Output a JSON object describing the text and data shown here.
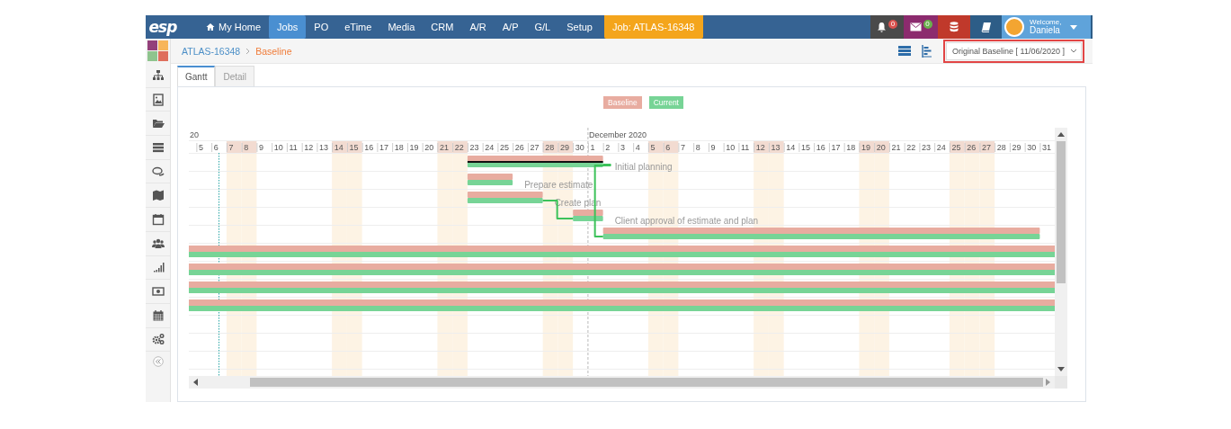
{
  "topbar": {
    "logo": "esp",
    "nav": [
      {
        "label": "My Home",
        "kind": "home",
        "selected": false
      },
      {
        "label": "Jobs",
        "kind": "plain",
        "selected": true
      },
      {
        "label": "PO",
        "kind": "plain",
        "selected": false
      },
      {
        "label": "eTime",
        "kind": "plain",
        "selected": false
      },
      {
        "label": "Media",
        "kind": "plain",
        "selected": false
      },
      {
        "label": "CRM",
        "kind": "plain",
        "selected": false
      },
      {
        "label": "A/R",
        "kind": "plain",
        "selected": false
      },
      {
        "label": "A/P",
        "kind": "plain",
        "selected": false
      },
      {
        "label": "G/L",
        "kind": "plain",
        "selected": false
      },
      {
        "label": "Setup",
        "kind": "plain",
        "selected": false
      }
    ],
    "job_button": "Job: ATLAS-16348",
    "notifications": {
      "count": "0"
    },
    "messages": {
      "count": "0"
    },
    "user": {
      "greeting": "Welcome,",
      "name": "Daniela"
    }
  },
  "breadcrumb": {
    "parent": "ATLAS-16348",
    "current": "Baseline"
  },
  "baseline_select": {
    "value": "Original Baseline [ 11/06/2020 ]"
  },
  "tabs": [
    {
      "label": "Gantt",
      "selected": true
    },
    {
      "label": "Detail",
      "selected": false
    }
  ],
  "legend": {
    "baseline": "Baseline",
    "current": "Current"
  },
  "timeline": {
    "months": [
      {
        "label": "20"
      },
      {
        "label": "December 2020"
      }
    ],
    "days": [
      {
        "label": "5",
        "weekend": false
      },
      {
        "label": "6",
        "weekend": false
      },
      {
        "label": "7",
        "weekend": true
      },
      {
        "label": "8",
        "weekend": true
      },
      {
        "label": "9",
        "weekend": false
      },
      {
        "label": "10",
        "weekend": false
      },
      {
        "label": "11",
        "weekend": false
      },
      {
        "label": "12",
        "weekend": false
      },
      {
        "label": "13",
        "weekend": false
      },
      {
        "label": "14",
        "weekend": true
      },
      {
        "label": "15",
        "weekend": true
      },
      {
        "label": "16",
        "weekend": false
      },
      {
        "label": "17",
        "weekend": false
      },
      {
        "label": "18",
        "weekend": false
      },
      {
        "label": "19",
        "weekend": false
      },
      {
        "label": "20",
        "weekend": false
      },
      {
        "label": "21",
        "weekend": true
      },
      {
        "label": "22",
        "weekend": true
      },
      {
        "label": "23",
        "weekend": false
      },
      {
        "label": "24",
        "weekend": false
      },
      {
        "label": "25",
        "weekend": false
      },
      {
        "label": "26",
        "weekend": false
      },
      {
        "label": "27",
        "weekend": false
      },
      {
        "label": "28",
        "weekend": true
      },
      {
        "label": "29",
        "weekend": true
      },
      {
        "label": "30",
        "weekend": false
      },
      {
        "label": "1",
        "weekend": false
      },
      {
        "label": "2",
        "weekend": false
      },
      {
        "label": "3",
        "weekend": false
      },
      {
        "label": "4",
        "weekend": false
      },
      {
        "label": "5",
        "weekend": true
      },
      {
        "label": "6",
        "weekend": true
      },
      {
        "label": "7",
        "weekend": false
      },
      {
        "label": "8",
        "weekend": false
      },
      {
        "label": "9",
        "weekend": false
      },
      {
        "label": "10",
        "weekend": false
      },
      {
        "label": "11",
        "weekend": false
      },
      {
        "label": "12",
        "weekend": true
      },
      {
        "label": "13",
        "weekend": true
      },
      {
        "label": "14",
        "weekend": false
      },
      {
        "label": "15",
        "weekend": false
      },
      {
        "label": "16",
        "weekend": false
      },
      {
        "label": "17",
        "weekend": false
      },
      {
        "label": "18",
        "weekend": false
      },
      {
        "label": "19",
        "weekend": true
      },
      {
        "label": "20",
        "weekend": true
      },
      {
        "label": "21",
        "weekend": false
      },
      {
        "label": "22",
        "weekend": false
      },
      {
        "label": "23",
        "weekend": false
      },
      {
        "label": "24",
        "weekend": false
      },
      {
        "label": "25",
        "weekend": true
      },
      {
        "label": "26",
        "weekend": true
      },
      {
        "label": "27",
        "weekend": true
      },
      {
        "label": "28",
        "weekend": false
      },
      {
        "label": "29",
        "weekend": false
      },
      {
        "label": "30",
        "weekend": false
      },
      {
        "label": "31",
        "weekend": false
      }
    ]
  },
  "tasks": [
    {
      "label": "Initial planning",
      "summary": true
    },
    {
      "label": "Prepare estimate",
      "summary": false
    },
    {
      "label": "Create plan",
      "summary": false
    },
    {
      "label": "Client approval of estimate and plan",
      "summary": false
    },
    {
      "summary": false
    },
    {
      "summary": false
    },
    {
      "summary": false
    },
    {
      "summary": false
    },
    {
      "summary": false
    }
  ]
}
